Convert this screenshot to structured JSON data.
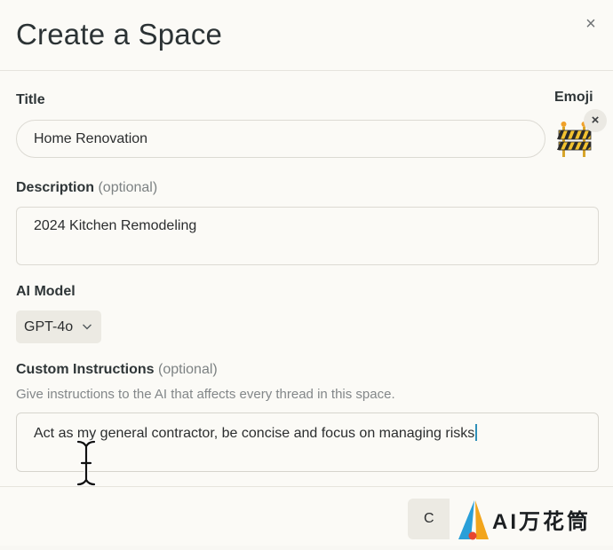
{
  "dialog": {
    "title": "Create a Space",
    "close_label": "×"
  },
  "fields": {
    "title_label": "Title",
    "title_value": "Home Renovation",
    "emoji_label": "Emoji",
    "emoji_icon": "construction-barrier-icon",
    "emoji_remove_label": "×",
    "description_label": "Description",
    "description_optional": "(optional)",
    "description_value": "2024 Kitchen Remodeling",
    "model_label": "AI Model",
    "model_value": "GPT-4o",
    "instructions_label": "Custom Instructions",
    "instructions_optional": "(optional)",
    "instructions_help": "Give instructions to the AI that affects every thread in this space.",
    "instructions_value": "Act as my general contractor, be concise and focus on managing risks"
  },
  "footer": {
    "button_label": "C"
  },
  "watermark": {
    "text": "AI万花筒"
  },
  "colors": {
    "background": "#fbfaf6",
    "text": "#2b2d2e",
    "muted": "#7d8283",
    "select_bg": "#eceae3",
    "caret": "#2f8fb8",
    "barrier_yellow": "#f2c230",
    "barrier_black": "#2a2a2a"
  }
}
